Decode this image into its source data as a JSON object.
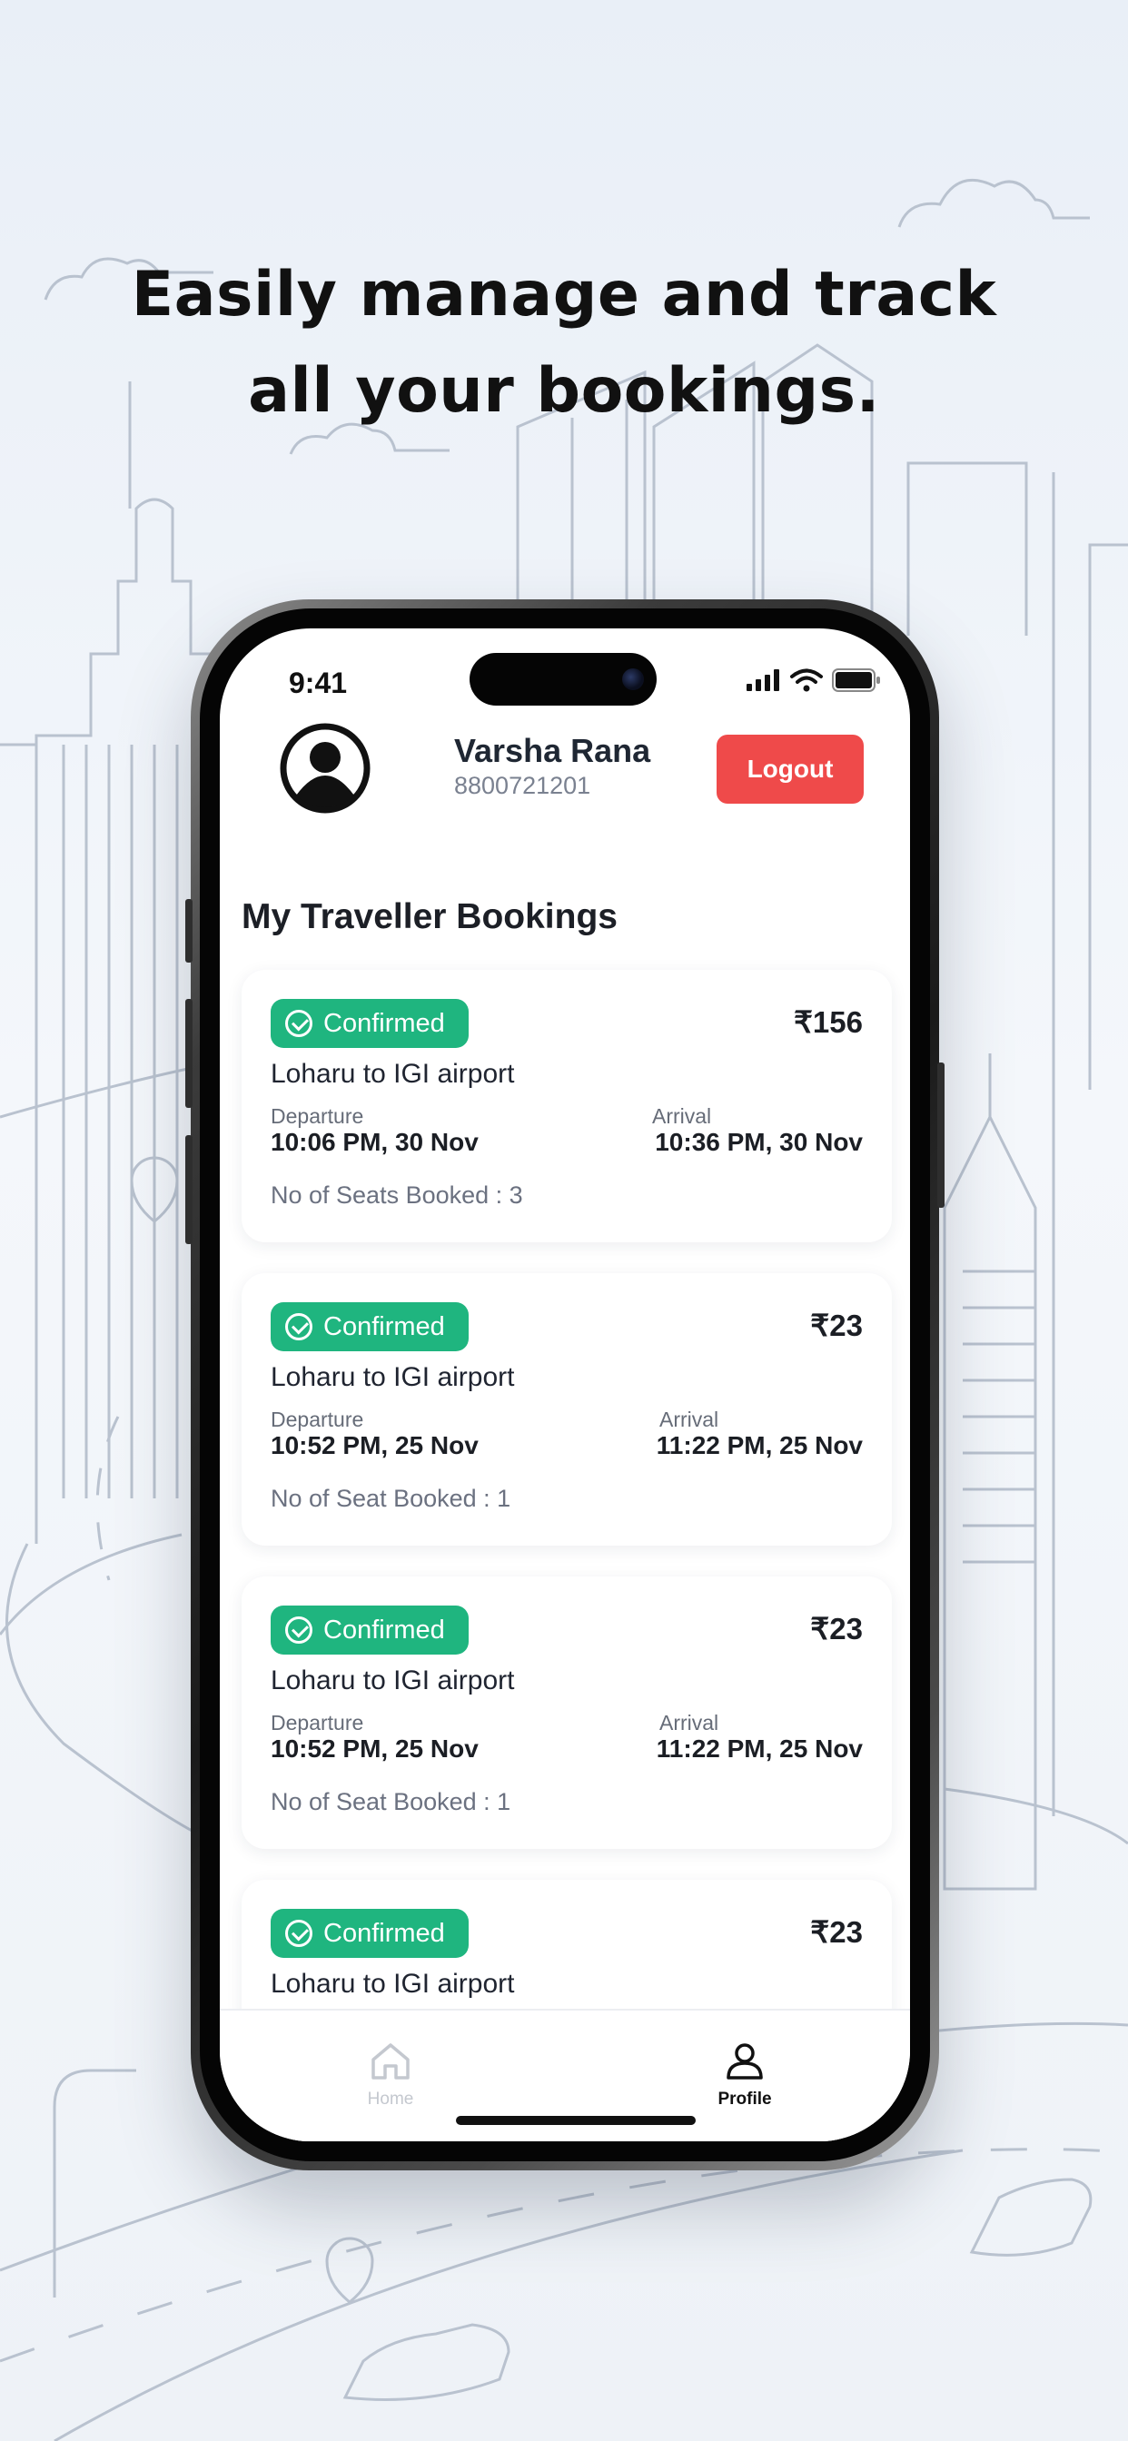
{
  "headline": {
    "line1": "Easily manage and track",
    "line2": "all your bookings."
  },
  "status_bar": {
    "time": "9:41"
  },
  "profile": {
    "name": "Varsha Rana",
    "phone": "8800721201",
    "logout_label": "Logout"
  },
  "section_title": "My Traveller Bookings",
  "bookings": [
    {
      "status": "Confirmed",
      "price": "₹156",
      "route": "Loharu to IGI airport",
      "departure_label": "Departure",
      "departure": "10:06 PM, 30 Nov",
      "arrival_label": "Arrival",
      "arrival": "10:36 PM, 30 Nov",
      "seats": "No of Seats Booked : 3"
    },
    {
      "status": "Confirmed",
      "price": "₹23",
      "route": "Loharu to IGI airport",
      "departure_label": "Departure",
      "departure": "10:52 PM, 25 Nov",
      "arrival_label": "Arrival",
      "arrival": "11:22 PM, 25 Nov",
      "seats": "No of Seat Booked : 1"
    },
    {
      "status": "Confirmed",
      "price": "₹23",
      "route": "Loharu to IGI airport",
      "departure_label": "Departure",
      "departure": "10:52 PM, 25 Nov",
      "arrival_label": "Arrival",
      "arrival": "11:22 PM, 25 Nov",
      "seats": "No of Seat Booked : 1"
    },
    {
      "status": "Confirmed",
      "price": "₹23",
      "route": "Loharu to IGI airport"
    }
  ],
  "tabbar": {
    "home_label": "Home",
    "profile_label": "Profile",
    "active": "profile"
  },
  "colors": {
    "confirmed": "#1fb57f",
    "logout": "#ef4a4a",
    "background": "#eef2f7"
  }
}
